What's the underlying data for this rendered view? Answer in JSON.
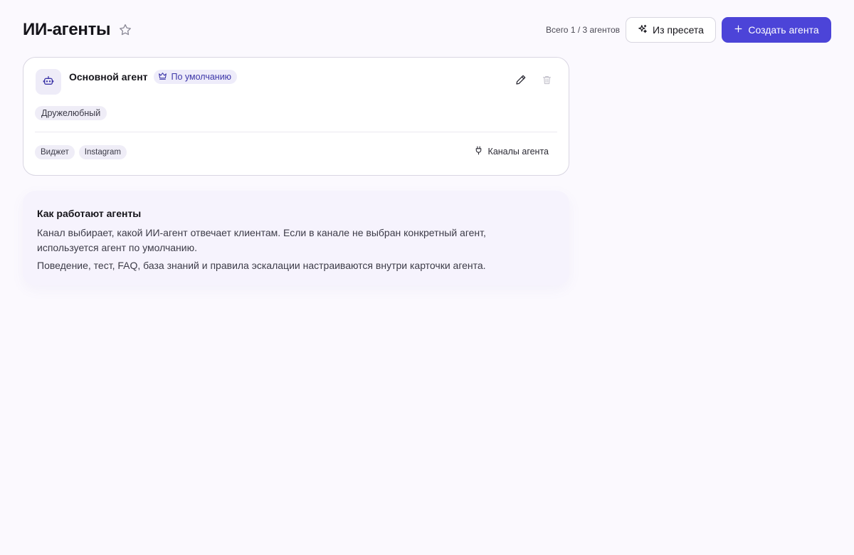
{
  "header": {
    "title": "ИИ-агенты",
    "count_text": "Всего 1 / 3 агентов",
    "preset_button": "Из пресета",
    "create_button": "Создать агента"
  },
  "agent_card": {
    "name": "Основной агент",
    "default_badge": "По умолчанию",
    "tone_tag": "Дружелюбный",
    "channels": [
      "Виджет",
      "Instagram"
    ],
    "channels_link": "Каналы агента"
  },
  "info": {
    "title": "Как работают агенты",
    "paragraph_1": "Канал выбирает, какой ИИ-агент отвечает клиентам. Если в канале не выбран конкретный агент, используется агент по умолчанию.",
    "paragraph_2": "Поведение, тест, FAQ, база знаний и правила эскалации настраиваются внутри карточки агента."
  },
  "icons": {
    "favorite": "star-icon",
    "preset": "sparkles-icon",
    "create": "plus-icon",
    "agent": "bot-icon",
    "default": "crown-icon",
    "edit": "pencil-icon",
    "delete": "trash-icon",
    "channels": "plug-icon"
  },
  "colors": {
    "primary": "#4c44d8",
    "background": "#fbf9fe",
    "badge_bg": "#eeecfa",
    "badge_text": "#3d36a8"
  }
}
